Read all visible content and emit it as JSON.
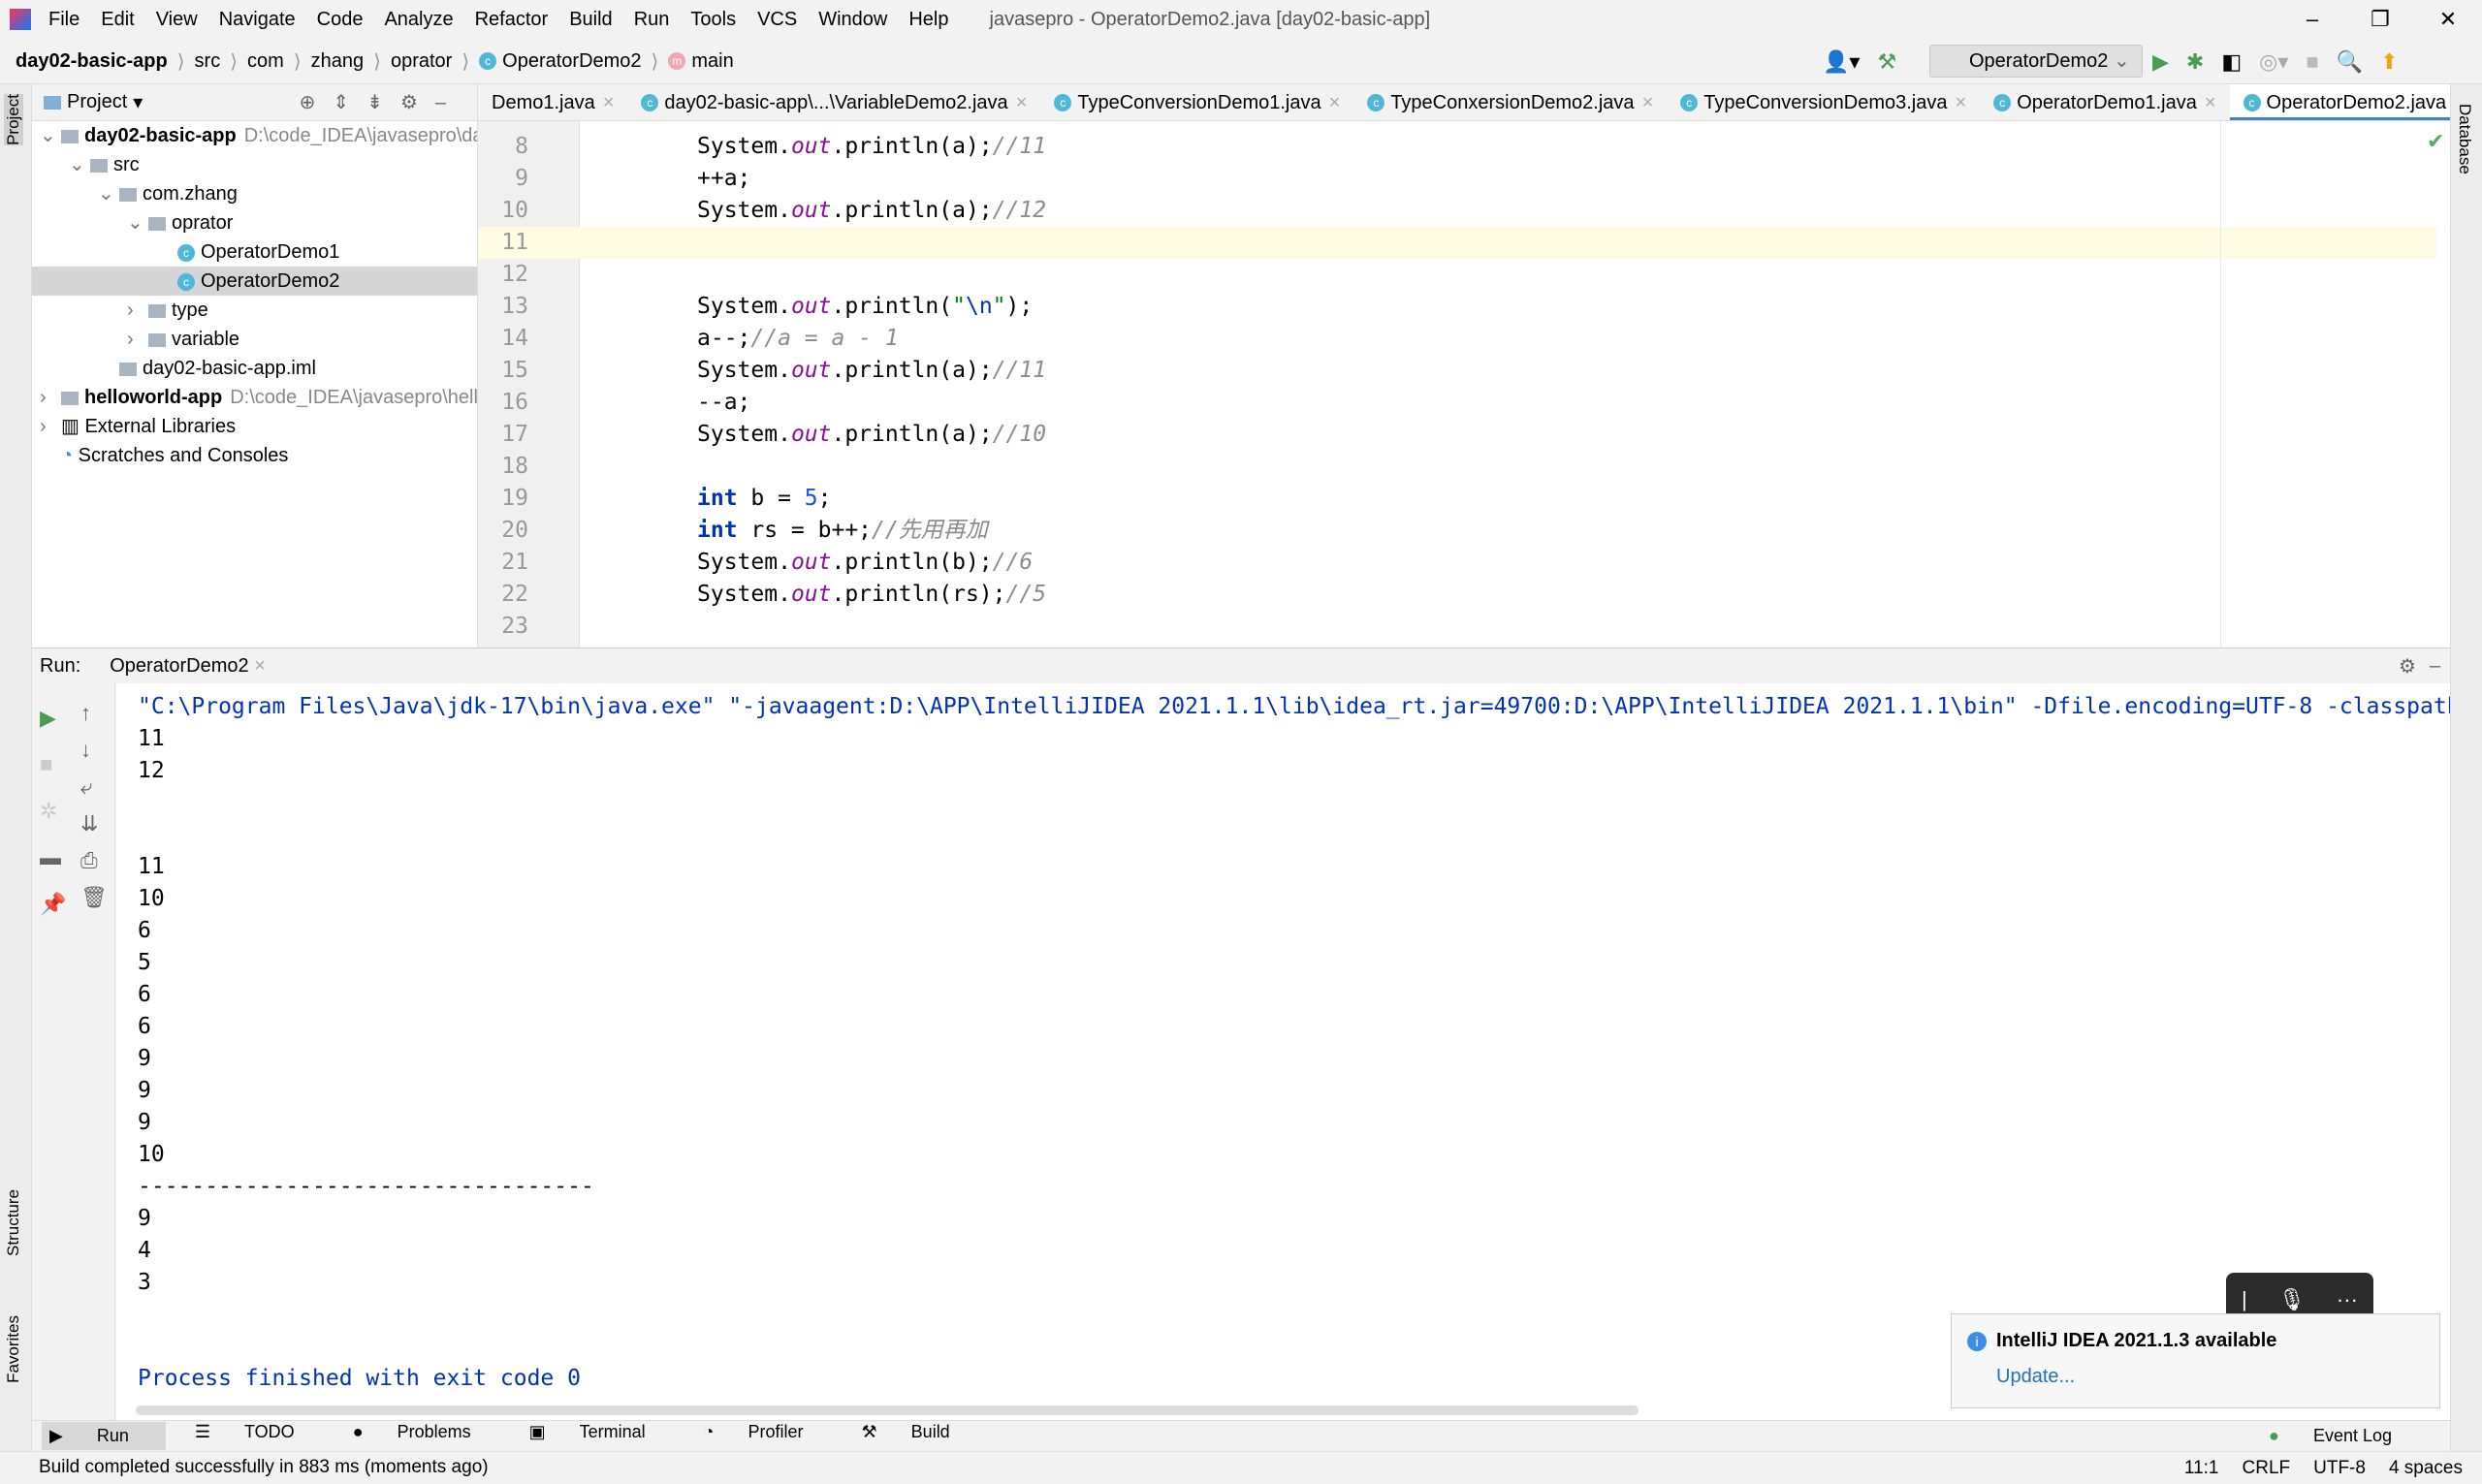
{
  "titlebar": {
    "menu": [
      "File",
      "Edit",
      "View",
      "Navigate",
      "Code",
      "Analyze",
      "Refactor",
      "Build",
      "Run",
      "Tools",
      "VCS",
      "Window",
      "Help"
    ],
    "title": "javasepro - OperatorDemo2.java [day02-basic-app]"
  },
  "breadcrumb": [
    "day02-basic-app",
    "src",
    "com",
    "zhang",
    "oprator",
    "OperatorDemo2",
    "main"
  ],
  "run_config": "OperatorDemo2",
  "project": {
    "label": "Project",
    "tree": [
      {
        "label": "day02-basic-app",
        "path": "D:\\code_IDEA\\javasepro\\day",
        "depth": 0,
        "bold": true,
        "arrow": "v",
        "type": "module"
      },
      {
        "label": "src",
        "depth": 1,
        "arrow": "v",
        "type": "folder"
      },
      {
        "label": "com.zhang",
        "depth": 2,
        "arrow": "v",
        "type": "folder"
      },
      {
        "label": "oprator",
        "depth": 3,
        "arrow": "v",
        "type": "folder"
      },
      {
        "label": "OperatorDemo1",
        "depth": 4,
        "type": "class"
      },
      {
        "label": "OperatorDemo2",
        "depth": 4,
        "type": "class",
        "selected": true
      },
      {
        "label": "type",
        "depth": 3,
        "arrow": ">",
        "type": "folder"
      },
      {
        "label": "variable",
        "depth": 3,
        "arrow": ">",
        "type": "folder"
      },
      {
        "label": "day02-basic-app.iml",
        "depth": 2,
        "type": "file"
      },
      {
        "label": "helloworld-app",
        "path": "D:\\code_IDEA\\javasepro\\hello",
        "depth": 0,
        "bold": true,
        "arrow": ">",
        "type": "module"
      },
      {
        "label": "External Libraries",
        "depth": 0,
        "arrow": ">",
        "type": "lib"
      },
      {
        "label": "Scratches and Consoles",
        "depth": 0,
        "type": "scratch"
      }
    ]
  },
  "tabs": [
    {
      "label": "Demo1.java"
    },
    {
      "label": "day02-basic-app\\...\\VariableDemo2.java"
    },
    {
      "label": "TypeConversionDemo1.java"
    },
    {
      "label": "TypeConxersionDemo2.java"
    },
    {
      "label": "TypeConversionDemo3.java"
    },
    {
      "label": "OperatorDemo1.java"
    },
    {
      "label": "OperatorDemo2.java",
      "active": true
    }
  ],
  "code_lines": [
    {
      "n": "8",
      "html": "System.<span class=fld>out</span>.println(a);<span class=cm>//11</span>"
    },
    {
      "n": "9",
      "html": "++a;"
    },
    {
      "n": "10",
      "html": "System.<span class=fld>out</span>.println(a);<span class=cm>//12</span>"
    },
    {
      "n": "11",
      "html": "",
      "current": true
    },
    {
      "n": "12",
      "html": ""
    },
    {
      "n": "13",
      "html": "System.<span class=fld>out</span>.println(<span class=str>\"<span class=esc>\\n</span>\"</span>);"
    },
    {
      "n": "14",
      "html": "a--;<span class=cm>//a = a - 1</span>"
    },
    {
      "n": "15",
      "html": "System.<span class=fld>out</span>.println(a);<span class=cm>//11</span>"
    },
    {
      "n": "16",
      "html": "--a;"
    },
    {
      "n": "17",
      "html": "System.<span class=fld>out</span>.println(a);<span class=cm>//10</span>"
    },
    {
      "n": "18",
      "html": ""
    },
    {
      "n": "19",
      "html": "<span class=kw>int</span> b = <span class=num>5</span>;"
    },
    {
      "n": "20",
      "html": "<span class=kw>int</span> rs = b++;<span class=cm>//先用再加</span>"
    },
    {
      "n": "21",
      "html": "System.<span class=fld>out</span>.println(b);<span class=cm>//6</span>"
    },
    {
      "n": "22",
      "html": "System.<span class=fld>out</span>.println(rs);<span class=cm>//5</span>"
    },
    {
      "n": "23",
      "html": ""
    }
  ],
  "run": {
    "label": "Run:",
    "tab": "OperatorDemo2",
    "console": [
      "\"C:\\Program Files\\Java\\jdk-17\\bin\\java.exe\" \"-javaagent:D:\\APP\\IntelliJIDEA 2021.1.1\\lib\\idea_rt.jar=49700:D:\\APP\\IntelliJIDEA 2021.1.1\\bin\" -Dfile.encoding=UTF-8 -classpath",
      "11",
      "12",
      "",
      "",
      "11",
      "10",
      "6",
      "5",
      "6",
      "6",
      "9",
      "9",
      "9",
      "10",
      "----------------------------------",
      "9",
      "4",
      "3",
      "",
      "",
      "Process finished with exit code 0"
    ]
  },
  "notification": {
    "title": "IntelliJ IDEA 2021.1.3 available",
    "link": "Update..."
  },
  "bottom_tabs": [
    "Run",
    "TODO",
    "Problems",
    "Terminal",
    "Profiler",
    "Build"
  ],
  "event_log": "Event Log",
  "status": {
    "message": "Build completed successfully in 883 ms (moments ago)",
    "position": "11:1",
    "line_sep": "CRLF",
    "encoding": "UTF-8",
    "indent": "4 spaces"
  },
  "side": {
    "project": "Project",
    "structure": "Structure",
    "favorites": "Favorites",
    "database": "Database"
  }
}
